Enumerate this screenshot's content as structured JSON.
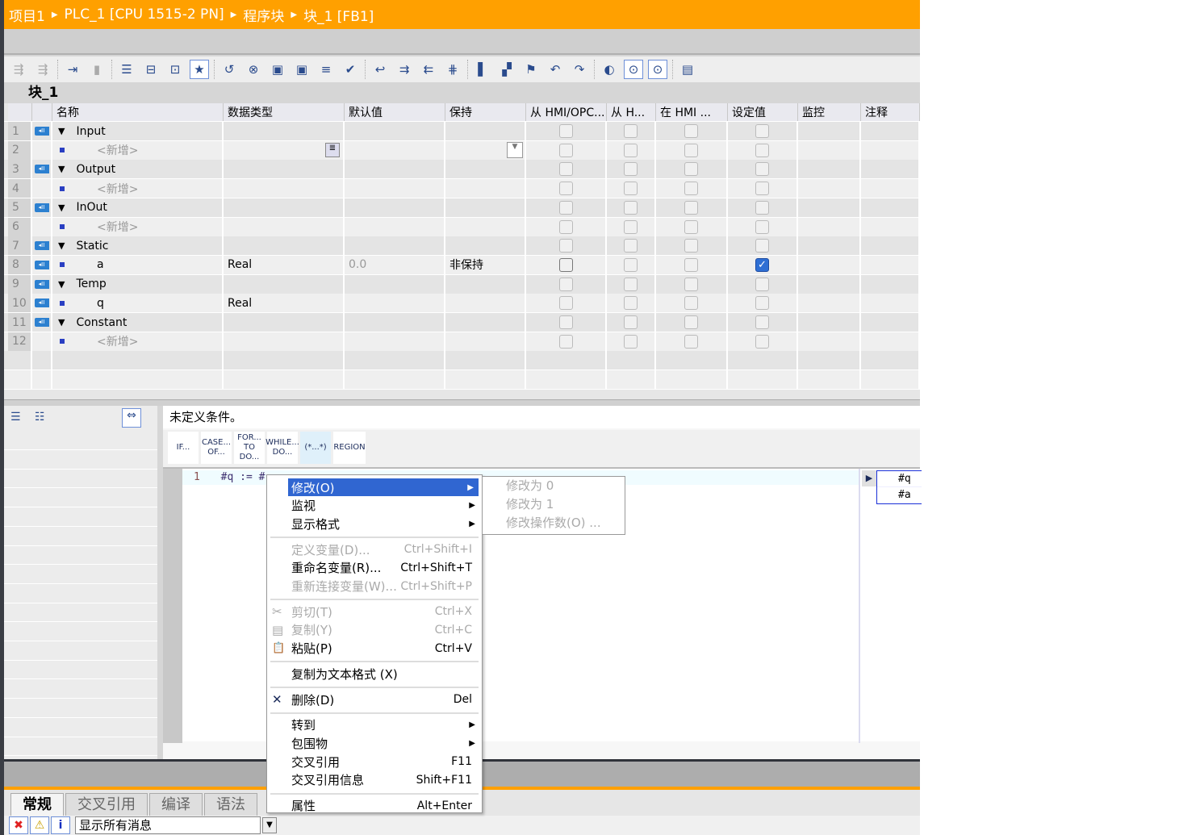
{
  "breadcrumb": [
    "项目1",
    "PLC_1 [CPU 1515-2 PN]",
    "程序块",
    "块_1 [FB1]"
  ],
  "toolbar": {
    "icons": [
      "insert-row-icon",
      "add-row-icon",
      "export-icon",
      "reset-icon",
      "indent-icon",
      "tag-icon",
      "comment-icon",
      "favorites-icon",
      "delete-network-icon",
      "delete-icon",
      "block-icon",
      "block2-icon",
      "list-icon",
      "check-icon",
      "goto-icon",
      "indent-more-icon",
      "indent-less-icon",
      "align-icon",
      "bookmark-icon",
      "bookmark-remove-icon",
      "bookmark-add-icon",
      "bookmark-prev-icon",
      "bookmark-next-icon",
      "monitor-icon",
      "glasses-icon",
      "glasses2-icon",
      "db-lock-icon"
    ]
  },
  "block_title": "块_1",
  "table": {
    "headers": [
      "名称",
      "数据类型",
      "默认值",
      "保持",
      "从 HMI/OPC...",
      "从 H...",
      "在 HMI ...",
      "设定值",
      "监控",
      "注释"
    ],
    "rows": [
      {
        "n": "1",
        "name": "Input",
        "section": true,
        "type": "",
        "default": "",
        "retain": "",
        "setpoint": false
      },
      {
        "n": "2",
        "name": "<新增>",
        "add": true,
        "type": "",
        "default": "",
        "retain": "",
        "setpoint": false
      },
      {
        "n": "3",
        "name": "Output",
        "section": true,
        "type": "",
        "default": "",
        "retain": "",
        "setpoint": false
      },
      {
        "n": "4",
        "name": "<新增>",
        "add": true,
        "type": "",
        "default": "",
        "retain": "",
        "setpoint": false
      },
      {
        "n": "5",
        "name": "InOut",
        "section": true,
        "type": "",
        "default": "",
        "retain": "",
        "setpoint": false
      },
      {
        "n": "6",
        "name": "<新增>",
        "add": true,
        "type": "",
        "default": "",
        "retain": "",
        "setpoint": false
      },
      {
        "n": "7",
        "name": "Static",
        "section": true,
        "type": "",
        "default": "",
        "retain": "",
        "setpoint": false
      },
      {
        "n": "8",
        "name": "a",
        "type": "Real",
        "default": "0.0",
        "retain": "非保持",
        "setpoint": true
      },
      {
        "n": "9",
        "name": "Temp",
        "section": true,
        "type": "",
        "default": "",
        "retain": "",
        "setpoint": false
      },
      {
        "n": "10",
        "name": "q",
        "type": "Real",
        "default": "",
        "retain": "",
        "setpoint": false
      },
      {
        "n": "11",
        "name": "Constant",
        "section": true,
        "type": "",
        "default": "",
        "retain": "",
        "setpoint": false
      },
      {
        "n": "12",
        "name": "<新增>",
        "add": true,
        "type": "",
        "default": "",
        "retain": "",
        "setpoint": false
      }
    ]
  },
  "editor": {
    "status": "未定义条件。",
    "snippets": [
      "IF...",
      "CASE... OF...",
      "FOR... TO DO...",
      "WHILE... DO...",
      "(*...*)",
      "REGION"
    ],
    "line_number": "1",
    "code": "#q := #",
    "autocomplete": [
      "#q",
      "#a"
    ]
  },
  "context_menu": [
    {
      "label": "修改(O)",
      "submenu": true,
      "highlight": true
    },
    {
      "label": "监视",
      "submenu": true
    },
    {
      "label": "显示格式",
      "submenu": true
    },
    {
      "sep": true
    },
    {
      "label": "定义变量(D)...",
      "shortcut": "Ctrl+Shift+I",
      "disabled": true
    },
    {
      "label": "重命名变量(R)...",
      "shortcut": "Ctrl+Shift+T"
    },
    {
      "label": "重新连接变量(W)...",
      "shortcut": "Ctrl+Shift+P",
      "disabled": true
    },
    {
      "sep": true
    },
    {
      "label": "剪切(T)",
      "shortcut": "Ctrl+X",
      "disabled": true,
      "icon": "scissors-icon"
    },
    {
      "label": "复制(Y)",
      "shortcut": "Ctrl+C",
      "disabled": true,
      "icon": "copy-icon"
    },
    {
      "label": "粘贴(P)",
      "shortcut": "Ctrl+V",
      "icon": "paste-icon"
    },
    {
      "sep": true
    },
    {
      "label": "复制为文本格式 (X)"
    },
    {
      "sep": true
    },
    {
      "label": "删除(D)",
      "shortcut": "Del",
      "icon": "delete-x-icon"
    },
    {
      "sep": true
    },
    {
      "label": "转到",
      "submenu": true
    },
    {
      "label": "包围物",
      "submenu": true
    },
    {
      "label": "交叉引用",
      "shortcut": "F11"
    },
    {
      "label": "交叉引用信息",
      "shortcut": "Shift+F11"
    },
    {
      "sep": true
    },
    {
      "label": "属性",
      "shortcut": "Alt+Enter"
    }
  ],
  "submenu": [
    "修改为 0",
    "修改为 1",
    "修改操作数(O) ..."
  ],
  "inspector": {
    "tabs": [
      "常规",
      "交叉引用",
      "编译",
      "语法"
    ],
    "active_tab": "常规",
    "filter": "显示所有消息"
  },
  "colors": {
    "accent": "#ffa000",
    "highlight": "#3066d1"
  }
}
